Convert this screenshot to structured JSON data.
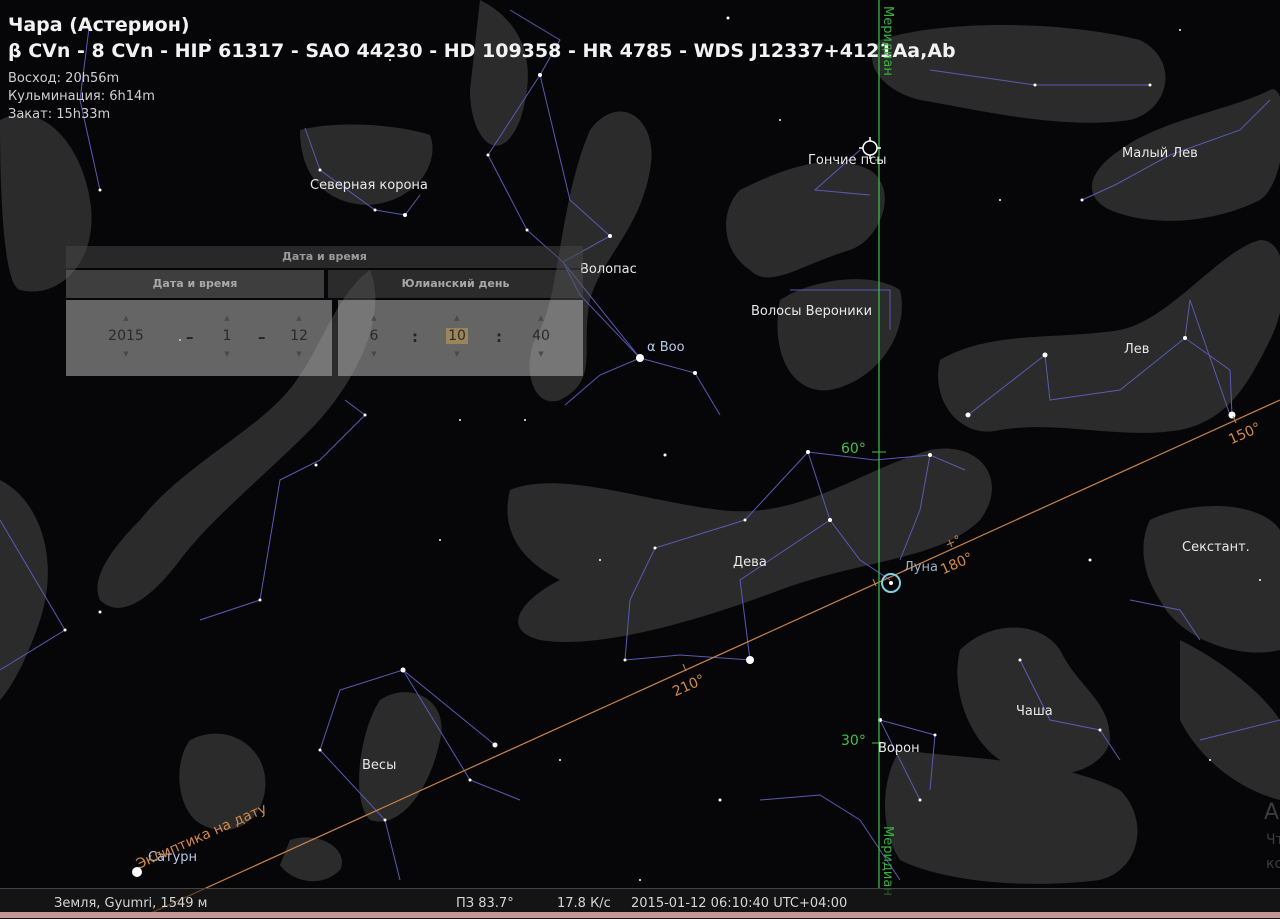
{
  "object": {
    "title": "Чара (Астерион)",
    "designations": "β CVn - 8 CVn - HIP 61317 - SAO 44230 - HD 109358 - HR 4785 - WDS J12337+4121Aa,Ab",
    "rise": "Восход: 20h56m",
    "culmination": "Кульминация: 6h14m",
    "set": "Закат: 15h33m"
  },
  "datetime_panel": {
    "title": "Дата и время",
    "tab_datetime": "Дата и время",
    "tab_julian": "Юлианский день",
    "year": "2015",
    "month": "1",
    "day": "12",
    "hour": "6",
    "minute": "10",
    "second": "40",
    "date_sep": "–",
    "time_sep": ":"
  },
  "constellations": {
    "corona_borealis": "Северная корона",
    "bootes": "Волопас",
    "canes_venatici": "Гончие псы",
    "leo_minor": "Малый Лев",
    "coma_berenices": "Волосы Вероники",
    "leo": "Лев",
    "virgo": "Дева",
    "sextans": "Секстант.",
    "crater": "Чаша",
    "corvus": "Ворон",
    "libra": "Весы"
  },
  "objects": {
    "arcturus": "α Boo",
    "moon": "Луна",
    "saturn": "Сатурн"
  },
  "grid": {
    "meridian": "Меридиан",
    "ecliptic": "Эклиптика на дату",
    "ecl_150": "150°",
    "ecl_180": "180°",
    "ecl_210": "210°",
    "alt_60": "60°",
    "alt_30": "30°",
    "ecl_marker": "+°"
  },
  "status_bar": {
    "location": "Земля, Gyumri, 1549 м",
    "fov": "ПЗ 83.7°",
    "fps": "17.8 К/с",
    "datetime": "2015-01-12 06:10:40 UTC+04:00"
  },
  "corner": {
    "big": "А",
    "line1": "Чт",
    "line2": "кс"
  },
  "colors": {
    "background": "#060608",
    "constellation_lines": "#5a5ab4",
    "ecliptic": "#c8824a",
    "meridian": "#3fc24a",
    "moon_marker": "#7fd0e0"
  }
}
